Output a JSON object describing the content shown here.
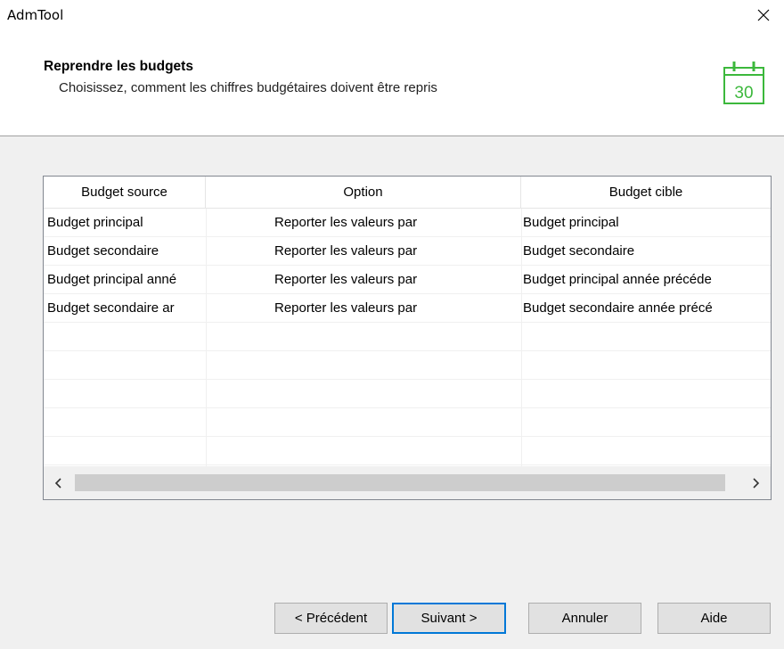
{
  "window": {
    "title": "AdmTool",
    "close_icon": "close-icon"
  },
  "header": {
    "title": "Reprendre les budgets",
    "subtitle": "Choisissez, comment les chiffres budgétaires doivent être repris",
    "calendar_icon": "calendar-icon",
    "calendar_day": "30",
    "accent_color": "#3cb83c"
  },
  "table": {
    "columns": [
      "Budget source",
      "Option",
      "Budget cible"
    ],
    "rows": [
      {
        "source": "Budget principal",
        "option": "Reporter les valeurs par",
        "target": "Budget principal"
      },
      {
        "source": "Budget secondaire",
        "option": "Reporter les valeurs par",
        "target": "Budget secondaire"
      },
      {
        "source": "Budget principal anné",
        "option": "Reporter les valeurs par",
        "target": "Budget principal année précéde"
      },
      {
        "source": "Budget secondaire ar",
        "option": "Reporter les valeurs par",
        "target": "Budget secondaire année précé"
      }
    ],
    "scroll_left_icon": "chevron-left-icon",
    "scroll_right_icon": "chevron-right-icon"
  },
  "buttons": {
    "previous": "< Précédent",
    "next": "Suivant >",
    "cancel": "Annuler",
    "help": "Aide",
    "default_border_color": "#0078d7"
  }
}
